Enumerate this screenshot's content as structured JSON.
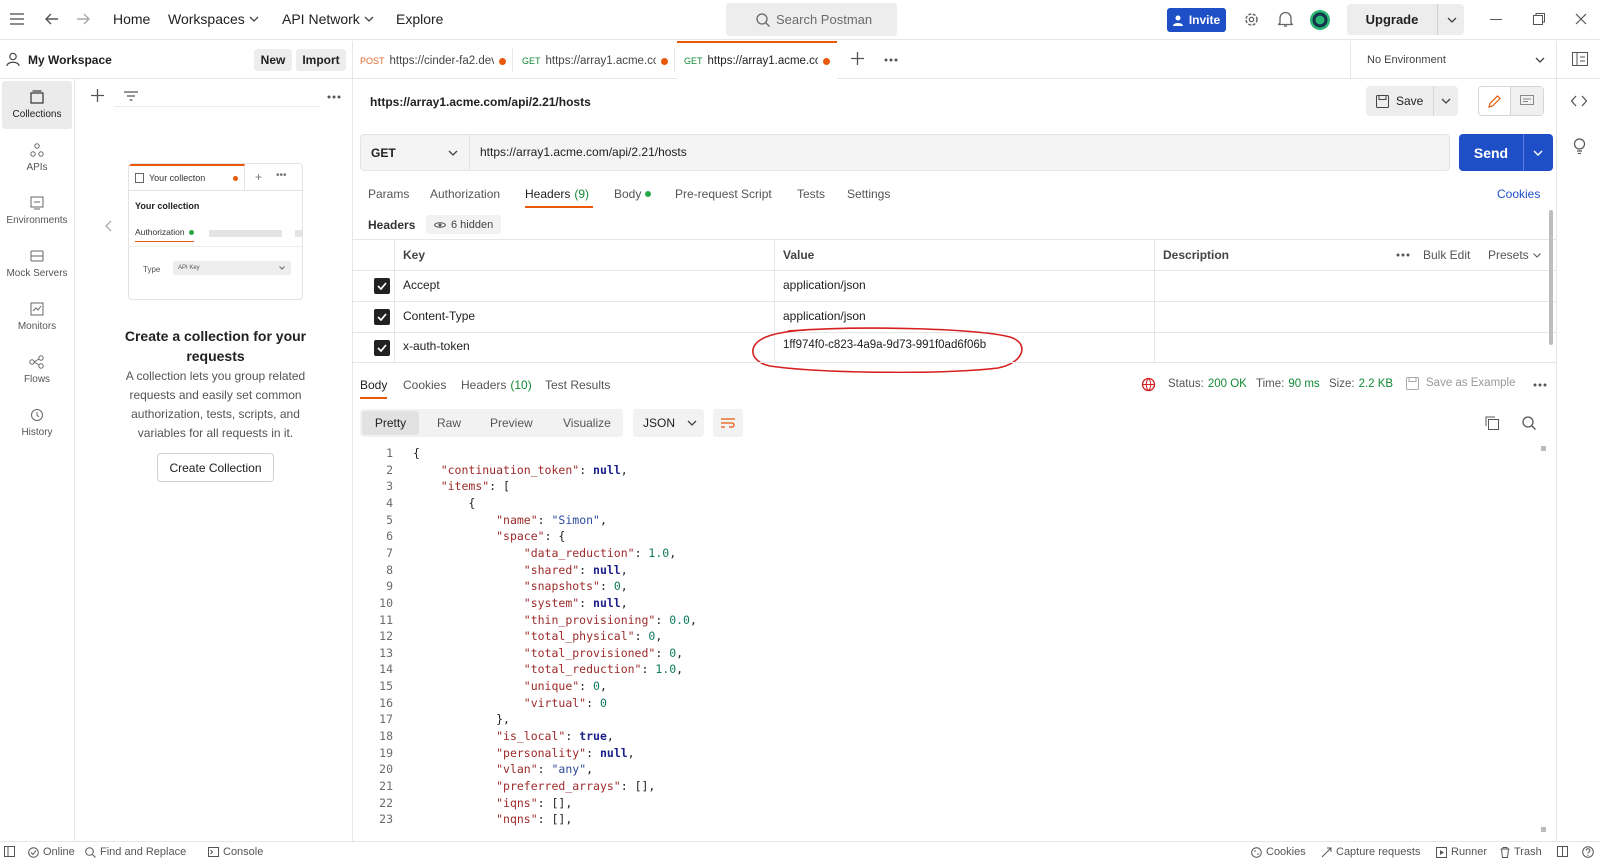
{
  "topbar": {
    "nav": [
      "Home",
      "Workspaces",
      "API Network",
      "Explore"
    ],
    "search_placeholder": "Search Postman",
    "invite": "Invite",
    "upgrade": "Upgrade"
  },
  "sidebar": {
    "workspace": "My Workspace",
    "new": "New",
    "import": "Import",
    "rail": [
      "Collections",
      "APIs",
      "Environments",
      "Mock Servers",
      "Monitors",
      "Flows",
      "History"
    ],
    "illustration": {
      "tab_label": "Your collecton",
      "title": "Your collection",
      "auth_tab": "Authorization",
      "type_label": "Type",
      "type_value": "API Key"
    },
    "empty_title": "Create a collection for your requests",
    "empty_desc": "A collection lets you group related requests and easily set common authorization, tests, scripts, and variables for all requests in it.",
    "create_button": "Create Collection"
  },
  "tabs": [
    {
      "method": "POST",
      "url": "https://cinder-fa2.dev"
    },
    {
      "method": "GET",
      "url": "https://array1.acme.co"
    },
    {
      "method": "GET",
      "url": "https://array1.acme.co"
    }
  ],
  "environment": "No Environment",
  "request": {
    "title": "https://array1.acme.com/api/2.21/hosts",
    "save": "Save",
    "method": "GET",
    "url": "https://array1.acme.com/api/2.21/hosts",
    "send": "Send",
    "subtabs": [
      "Params",
      "Authorization",
      "Headers",
      "(9)",
      "Body",
      "Pre-request Script",
      "Tests",
      "Settings"
    ],
    "cookies": "Cookies",
    "headers_label": "Headers",
    "hidden": "6 hidden",
    "columns": [
      "Key",
      "Value",
      "Description"
    ],
    "bulk_edit": "Bulk Edit",
    "presets": "Presets",
    "headers": [
      {
        "key": "Accept",
        "value": "application/json"
      },
      {
        "key": "Content-Type",
        "value": "application/json"
      },
      {
        "key": "x-auth-token",
        "value": "1ff974f0-c823-4a9a-9d73-991f0ad6f06b"
      }
    ]
  },
  "response": {
    "tabs": [
      "Body",
      "Cookies",
      "Headers",
      "(10)",
      "Test Results"
    ],
    "status_label": "Status:",
    "status": "200 OK",
    "time_label": "Time:",
    "time": "90 ms",
    "size_label": "Size:",
    "size": "2.2 KB",
    "save_example": "Save as Example",
    "views": [
      "Pretty",
      "Raw",
      "Preview",
      "Visualize"
    ],
    "format": "JSON",
    "lines": [
      "{",
      "    \"continuation_token\": null,",
      "    \"items\": [",
      "        {",
      "            \"name\": \"Simon\",",
      "            \"space\": {",
      "                \"data_reduction\": 1.0,",
      "                \"shared\": null,",
      "                \"snapshots\": 0,",
      "                \"system\": null,",
      "                \"thin_provisioning\": 0.0,",
      "                \"total_physical\": 0,",
      "                \"total_provisioned\": 0,",
      "                \"total_reduction\": 1.0,",
      "                \"unique\": 0,",
      "                \"virtual\": 0",
      "            },",
      "            \"is_local\": true,",
      "            \"personality\": null,",
      "            \"vlan\": \"any\",",
      "            \"preferred_arrays\": [],",
      "            \"iqns\": [],",
      "            \"nqns\": [],"
    ]
  },
  "statusbar": {
    "online": "Online",
    "find": "Find and Replace",
    "console": "Console",
    "cookies": "Cookies",
    "capture": "Capture requests",
    "runner": "Runner",
    "trash": "Trash"
  }
}
